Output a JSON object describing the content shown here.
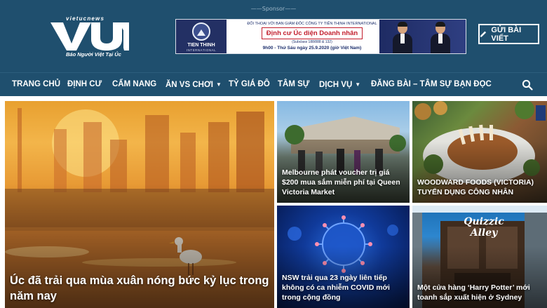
{
  "header": {
    "sponsor_label": "——Sponsor——",
    "logo_tag": "vietucnews",
    "logo_word": "VUN",
    "logo_slogan": "Báo Người Việt Tại Úc",
    "submit_button": "GỬI BÀI VIẾT",
    "submit_icon": "pencil-icon"
  },
  "banner": {
    "brand_name": "TIEN THINH",
    "brand_sub": "INTERNATIONAL",
    "headline_small": "ĐỐI THOẠI VỚI BAN GIÁM ĐỐC CÔNG TY TIẾN THỊNH INTERNATIONAL",
    "headline_big": "Định cư Úc diện Doanh nhân",
    "headline_paren": "(Subclass 188/888 & 132)",
    "headline_date": "9h00 - Thứ Sáu ngày 25.9.2020 (giờ Việt Nam)"
  },
  "nav": {
    "items": [
      {
        "label": "TRANG CHỦ",
        "dropdown": false
      },
      {
        "label": "ĐỊNH CƯ",
        "dropdown": false
      },
      {
        "label": "CẨM NANG",
        "dropdown": false
      },
      {
        "label": "ĂN VS CHƠI",
        "dropdown": true
      },
      {
        "label": "TỶ GIÁ ĐÔ",
        "dropdown": false
      },
      {
        "label": "TÂM SỰ",
        "dropdown": false
      },
      {
        "label": "DỊCH VỤ",
        "dropdown": true
      },
      {
        "label": "ĐĂNG BÀI – TÂM SỰ BẠN ĐỌC",
        "dropdown": false
      }
    ],
    "search_icon": "search-icon"
  },
  "articles": {
    "hero": {
      "title": "Úc đã trải qua mùa xuân nóng bức kỷ lục trong năm nay"
    },
    "a1": {
      "title": "Melbourne phát voucher trị giá $200 mua sắm miễn phí tại Queen Victoria Market"
    },
    "a2": {
      "title": "WOODWARD FOODS (VICTORIA) TUYỂN DỤNG CÔNG NHÂN"
    },
    "a3": {
      "title": "NSW trải qua 23 ngày liên tiếp không có ca nhiễm COVID mới trong cộng đồng"
    },
    "a4": {
      "title": "Một cửa hàng ‘Harry Potter’ mới toanh sắp xuất hiện ở Sydney"
    },
    "a4_sign": "Quizzic Alley"
  },
  "colors": {
    "header_bg": "#1f4f6e",
    "accent_red": "#c21d2c",
    "banner_navy": "#1b2d6b"
  }
}
